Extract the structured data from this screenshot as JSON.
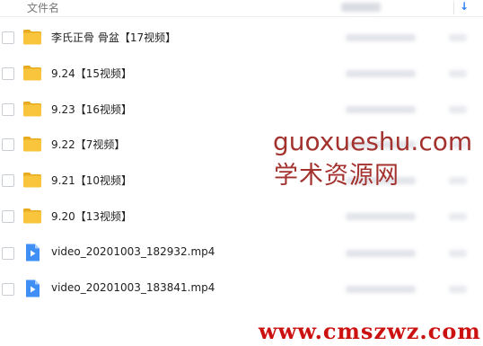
{
  "header": {
    "name_col": "文件名",
    "sort_icon": "sort-down-arrow-icon",
    "sort_glyph": "↓"
  },
  "files": [
    {
      "name": "李氏正骨 骨盆【17视频】",
      "type": "folder",
      "icon": "folder-icon"
    },
    {
      "name": "9.24【15视频】",
      "type": "folder",
      "icon": "folder-icon"
    },
    {
      "name": "9.23【16视频】",
      "type": "folder",
      "icon": "folder-icon"
    },
    {
      "name": "9.22【7视频】",
      "type": "folder",
      "icon": "folder-icon"
    },
    {
      "name": "9.21【10视频】",
      "type": "folder",
      "icon": "folder-icon"
    },
    {
      "name": "9.20【13视频】",
      "type": "folder",
      "icon": "folder-icon"
    },
    {
      "name": "video_20201003_182932.mp4",
      "type": "video",
      "icon": "video-file-icon"
    },
    {
      "name": "video_20201003_183841.mp4",
      "type": "video",
      "icon": "video-file-icon"
    }
  ],
  "watermarks": {
    "line1": "guoxueshu.com",
    "line2": "学术资源网",
    "line3": "www.cmszwz.com"
  },
  "colors": {
    "folder": "#f8c53c",
    "video": "#3f8ff7",
    "watermark_brown": "#a3322e",
    "watermark_red": "#cc1111"
  }
}
